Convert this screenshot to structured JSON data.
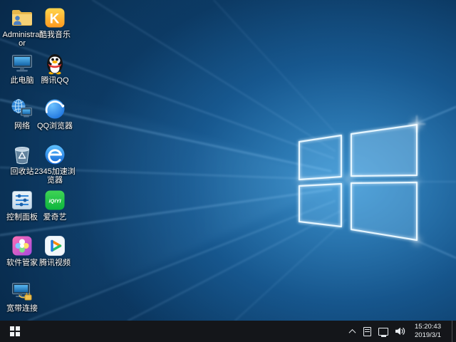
{
  "desktop": {
    "icons": [
      {
        "name": "administrator",
        "label": "Administrator"
      },
      {
        "name": "this-pc",
        "label": "此电脑"
      },
      {
        "name": "network",
        "label": "网络"
      },
      {
        "name": "recycle-bin",
        "label": "回收站"
      },
      {
        "name": "control-panel",
        "label": "控制面板"
      },
      {
        "name": "software-manager",
        "label": "软件管家"
      },
      {
        "name": "broadband-connection",
        "label": "宽带连接"
      },
      {
        "name": "kuwo-music",
        "label": "酷我音乐"
      },
      {
        "name": "tencent-qq",
        "label": "腾讯QQ"
      },
      {
        "name": "qq-browser",
        "label": "QQ浏览器"
      },
      {
        "name": "2345-browser",
        "label": "2345加速浏览器"
      },
      {
        "name": "iqiyi",
        "label": "爱奇艺"
      },
      {
        "name": "tencent-video",
        "label": "腾讯视频"
      }
    ],
    "icon_glyphs": {
      "kuwo": "K",
      "iqiyi": "iQIYI"
    }
  },
  "taskbar": {
    "clock": {
      "time": "15:20:43",
      "date": "2019/3/1"
    }
  },
  "colors": {
    "wallpaper_accent": "#2f8fd6",
    "taskbar": "#14161a",
    "label_text": "#ffffff"
  }
}
